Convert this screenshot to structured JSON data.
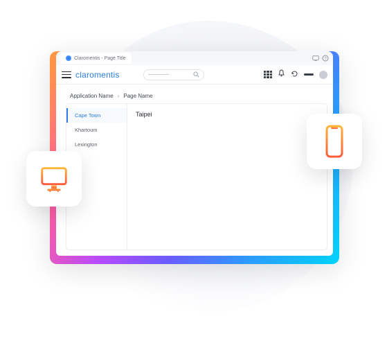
{
  "browser_tab": {
    "title": "Claromentis - Page Title"
  },
  "brand": "claromentis",
  "search": {
    "placeholder": ""
  },
  "breadcrumb": {
    "app": "Application Name",
    "page": "Page Name"
  },
  "sidebar": {
    "items": [
      {
        "label": "Cape Town",
        "active": true
      },
      {
        "label": "Khartoum",
        "active": false
      },
      {
        "label": "Lexington",
        "active": false
      }
    ]
  },
  "main": {
    "title": "Taipei"
  },
  "icons": {
    "desktop": "desktop-monitor-icon",
    "mobile": "mobile-phone-icon"
  }
}
